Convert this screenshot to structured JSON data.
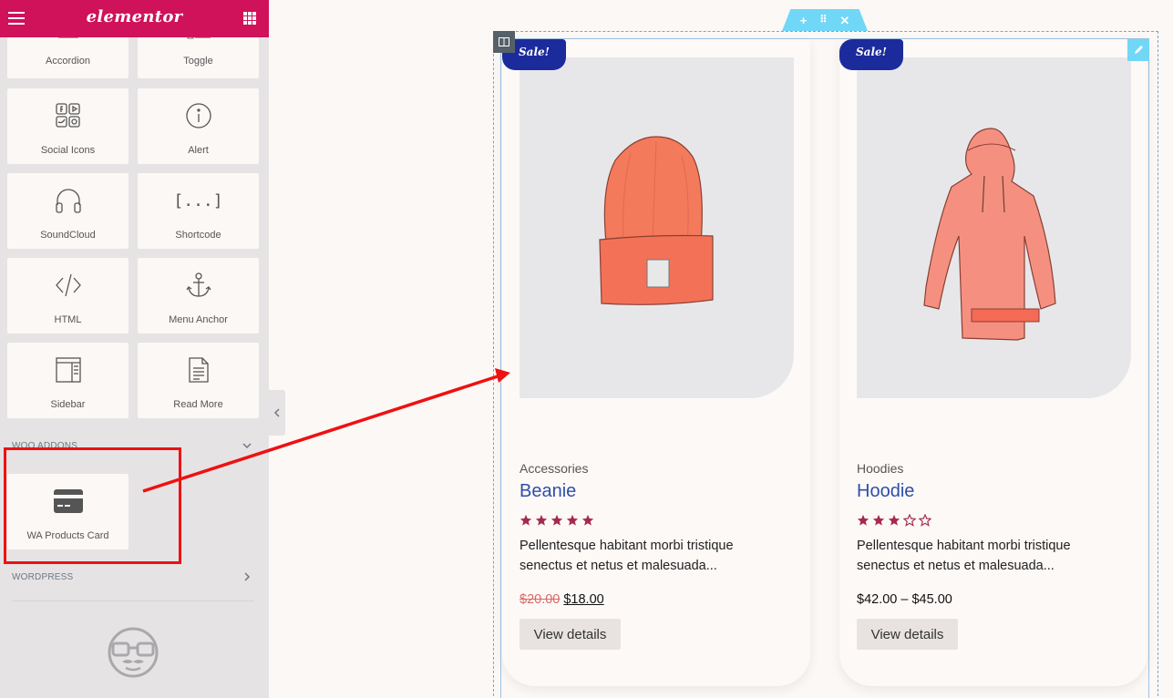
{
  "sidebar": {
    "logo": "elementor",
    "widgets": [
      {
        "label": "Accordion",
        "icon": "accordion-icon"
      },
      {
        "label": "Toggle",
        "icon": "toggle-icon"
      },
      {
        "label": "Social Icons",
        "icon": "social-icons-icon"
      },
      {
        "label": "Alert",
        "icon": "alert-icon"
      },
      {
        "label": "SoundCloud",
        "icon": "headphones-icon"
      },
      {
        "label": "Shortcode",
        "icon": "shortcode-icon"
      },
      {
        "label": "HTML",
        "icon": "code-icon"
      },
      {
        "label": "Menu Anchor",
        "icon": "anchor-icon"
      },
      {
        "label": "Sidebar",
        "icon": "sidebar-layout-icon"
      },
      {
        "label": "Read More",
        "icon": "document-icon"
      }
    ],
    "woo_section": {
      "title": "WOO ADDONS",
      "widget": {
        "label": "WA Products Card",
        "icon": "credit-card-icon"
      }
    },
    "wordpress_section": {
      "title": "WORDPRESS"
    }
  },
  "canvas": {
    "products": [
      {
        "badge": "Sale!",
        "category": "Accessories",
        "name": "Beanie",
        "rating": 5,
        "description": "Pellentesque habitant morbi tristique senectus et netus et malesuada...",
        "price_old": "$20.00",
        "price_new": "$18.00",
        "price_range": "",
        "button": "View details",
        "image": "beanie"
      },
      {
        "badge": "Sale!",
        "category": "Hoodies",
        "name": "Hoodie",
        "rating": 3,
        "description": "Pellentesque habitant morbi tristique senectus et netus et malesuada...",
        "price_old": "",
        "price_new": "",
        "price_range": "$42.00 – $45.00",
        "button": "View details",
        "image": "hoodie"
      }
    ]
  },
  "colors": {
    "brand": "#cf1259",
    "badge": "#1c2b9c",
    "product_title": "#2e4fa8",
    "star": "#a52a4e",
    "annotation": "#ee1111",
    "handle": "#71d7f7"
  }
}
